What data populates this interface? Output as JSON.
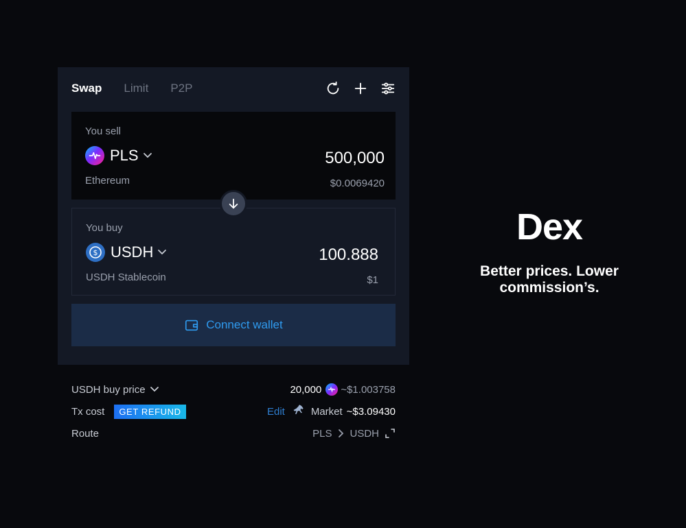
{
  "tabs": [
    {
      "label": "Swap",
      "active": true
    },
    {
      "label": "Limit",
      "active": false
    },
    {
      "label": "P2P",
      "active": false
    }
  ],
  "toolbar_icons": [
    "refresh-icon",
    "plus-icon",
    "settings-sliders-icon"
  ],
  "sell": {
    "label": "You sell",
    "token": "PLS",
    "network": "Ethereum",
    "amount": "500,000",
    "fiat": "$0.0069420"
  },
  "buy": {
    "label": "You buy",
    "token": "USDH",
    "network": "USDH Stablecoin",
    "amount": "100.888",
    "fiat": "$1"
  },
  "connect_label": "Connect wallet",
  "info": {
    "price_label": "USDH buy price",
    "price_amount": "20,000",
    "price_usd": "~$1.003758",
    "tx_label": "Tx cost",
    "refund_badge": "GET REFUND",
    "edit_label": "Edit",
    "market_label": "Market",
    "market_value": "~$3.09430",
    "route_label": "Route",
    "route_from": "PLS",
    "route_to": "USDH"
  },
  "hero": {
    "title": "Dex",
    "tagline": "Better prices. Lower commission’s."
  },
  "colors": {
    "background": "#08090d",
    "card": "#141925",
    "accent": "#2f9bf0",
    "badge_start": "#1d6ff2",
    "badge_end": "#19b8e8"
  }
}
